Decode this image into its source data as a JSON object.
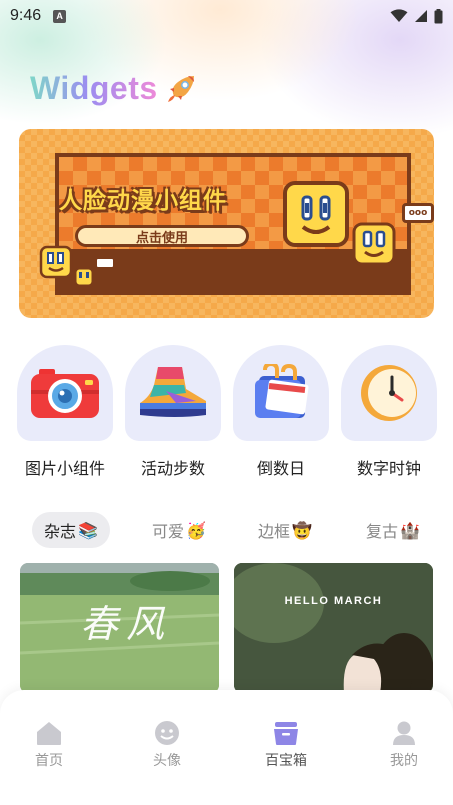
{
  "status_bar": {
    "time": "9:46",
    "notification_letter": "A"
  },
  "header": {
    "logo_text": "Widgets"
  },
  "banner": {
    "title": "人脸动漫小组件",
    "button_label": "点击使用",
    "bubble_text": "ooo"
  },
  "categories": [
    {
      "label": "图片小组件",
      "icon": "camera-icon"
    },
    {
      "label": "活动步数",
      "icon": "sneaker-icon"
    },
    {
      "label": "倒数日",
      "icon": "calendar-icon"
    },
    {
      "label": "数字时钟",
      "icon": "clock-icon"
    }
  ],
  "tabs": [
    {
      "label": "杂志",
      "emoji": "📚",
      "active": true
    },
    {
      "label": "可爱",
      "emoji": "🥳",
      "active": false
    },
    {
      "label": "边框",
      "emoji": "🤠",
      "active": false
    },
    {
      "label": "复古",
      "emoji": "🏰",
      "active": false
    }
  ],
  "cards": [
    {
      "script_text": "春风"
    },
    {
      "title": "HELLO MARCH"
    }
  ],
  "bottom_nav": [
    {
      "label": "首页",
      "icon": "home-icon",
      "active": false
    },
    {
      "label": "头像",
      "icon": "smiley-icon",
      "active": false
    },
    {
      "label": "百宝箱",
      "icon": "treasure-box-icon",
      "active": true
    },
    {
      "label": "我的",
      "icon": "user-icon",
      "active": false
    }
  ],
  "colors": {
    "accent": "#9b8df0",
    "tile_bg": "#e9ebfa",
    "banner_dark": "#7a3b1a"
  }
}
